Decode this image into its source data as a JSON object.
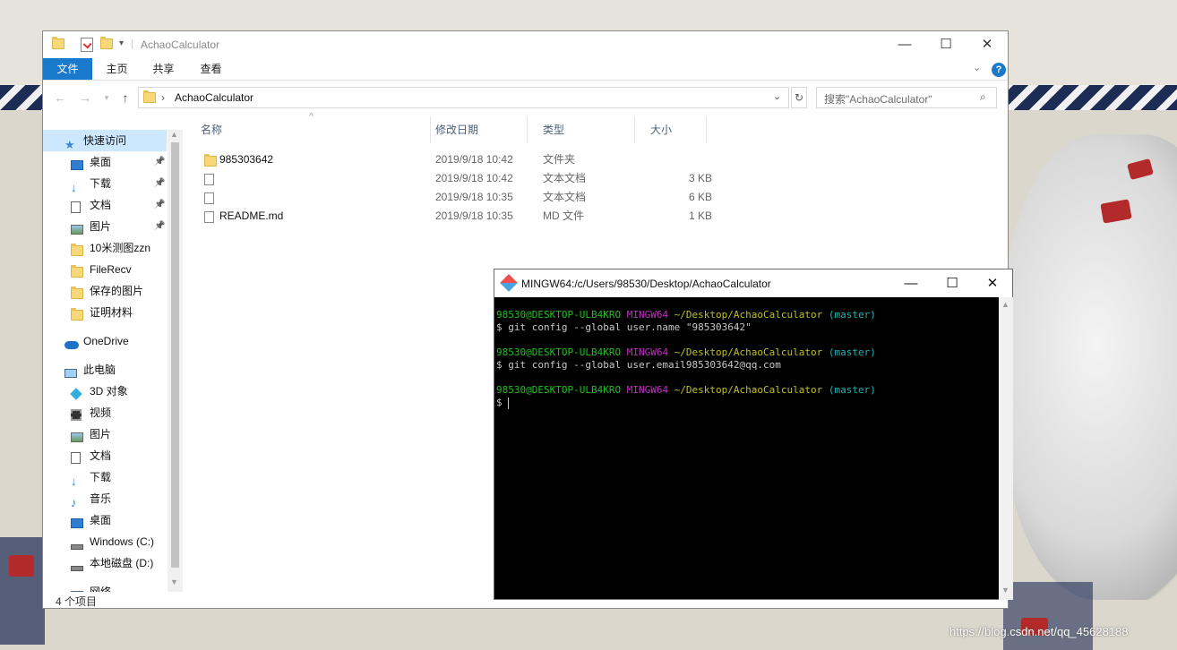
{
  "explorer": {
    "title": "AchaoCalculator",
    "ribbon_tabs": [
      "文件",
      "主页",
      "共享",
      "查看"
    ],
    "address": "AchaoCalculator",
    "search_placeholder": "搜索\"AchaoCalculator\"",
    "columns": [
      "名称",
      "修改日期",
      "类型",
      "大小"
    ],
    "nav_items": [
      {
        "label": "快速访问",
        "icon": "star-icon",
        "pinned": false,
        "selected": true
      },
      {
        "label": "桌面",
        "icon": "desktop-icon",
        "pinned": true
      },
      {
        "label": "下载",
        "icon": "download-icon",
        "pinned": true
      },
      {
        "label": "文档",
        "icon": "document-icon",
        "pinned": true
      },
      {
        "label": "图片",
        "icon": "picture-icon",
        "pinned": true
      },
      {
        "label": "10米测图zzn",
        "icon": "folder-icon",
        "pinned": false
      },
      {
        "label": "FileRecv",
        "icon": "folder-icon",
        "pinned": false
      },
      {
        "label": "保存的图片",
        "icon": "folder-icon",
        "pinned": false
      },
      {
        "label": "证明材料",
        "icon": "folder-icon",
        "pinned": false
      },
      {
        "label": "OneDrive",
        "icon": "cloud-icon",
        "pinned": false
      },
      {
        "label": "此电脑",
        "icon": "computer-icon",
        "pinned": false
      },
      {
        "label": "3D 对象",
        "icon": "cube-icon",
        "pinned": false
      },
      {
        "label": "视频",
        "icon": "video-icon",
        "pinned": false
      },
      {
        "label": "图片",
        "icon": "picture-icon",
        "pinned": false
      },
      {
        "label": "文档",
        "icon": "document-icon",
        "pinned": false
      },
      {
        "label": "下载",
        "icon": "download-icon",
        "pinned": false
      },
      {
        "label": "音乐",
        "icon": "music-icon",
        "pinned": false
      },
      {
        "label": "桌面",
        "icon": "desktop-icon",
        "pinned": false
      },
      {
        "label": "Windows (C:)",
        "icon": "drive-icon",
        "pinned": false
      },
      {
        "label": "本地磁盘 (D:)",
        "icon": "drive-icon",
        "pinned": false
      },
      {
        "label": "网络",
        "icon": "network-icon",
        "pinned": false
      }
    ],
    "files": [
      {
        "name": "985303642",
        "date": "2019/9/18 10:42",
        "type": "文件夹",
        "size": "",
        "kind": "folder"
      },
      {
        "name": "",
        "date": "2019/9/18 10:42",
        "type": "文本文档",
        "size": "3 KB",
        "kind": "text"
      },
      {
        "name": "",
        "date": "2019/9/18 10:35",
        "type": "文本文档",
        "size": "6 KB",
        "kind": "text"
      },
      {
        "name": "README.md",
        "date": "2019/9/18 10:35",
        "type": "MD 文件",
        "size": "1 KB",
        "kind": "text"
      }
    ],
    "status": "4 个项目"
  },
  "terminal": {
    "title": "MINGW64:/c/Users/98530/Desktop/AchaoCalculator",
    "prompt_user": "98530@DESKTOP-ULB4KRO",
    "prompt_env": "MINGW64",
    "prompt_path": "~/Desktop/AchaoCalculator",
    "prompt_branch": "(master)",
    "commands": [
      "$ git config --global user.name \"985303642\"",
      "$ git config --global user.email985303642@qq.com",
      "$ "
    ]
  },
  "watermark": "https://blog.csdn.net/qq_45628188",
  "colors": {
    "accent": "#1979ca",
    "prompt_user": "#1fbf1f",
    "prompt_env": "#c22fc2",
    "prompt_path": "#c0c020",
    "prompt_branch": "#22b3b3"
  }
}
